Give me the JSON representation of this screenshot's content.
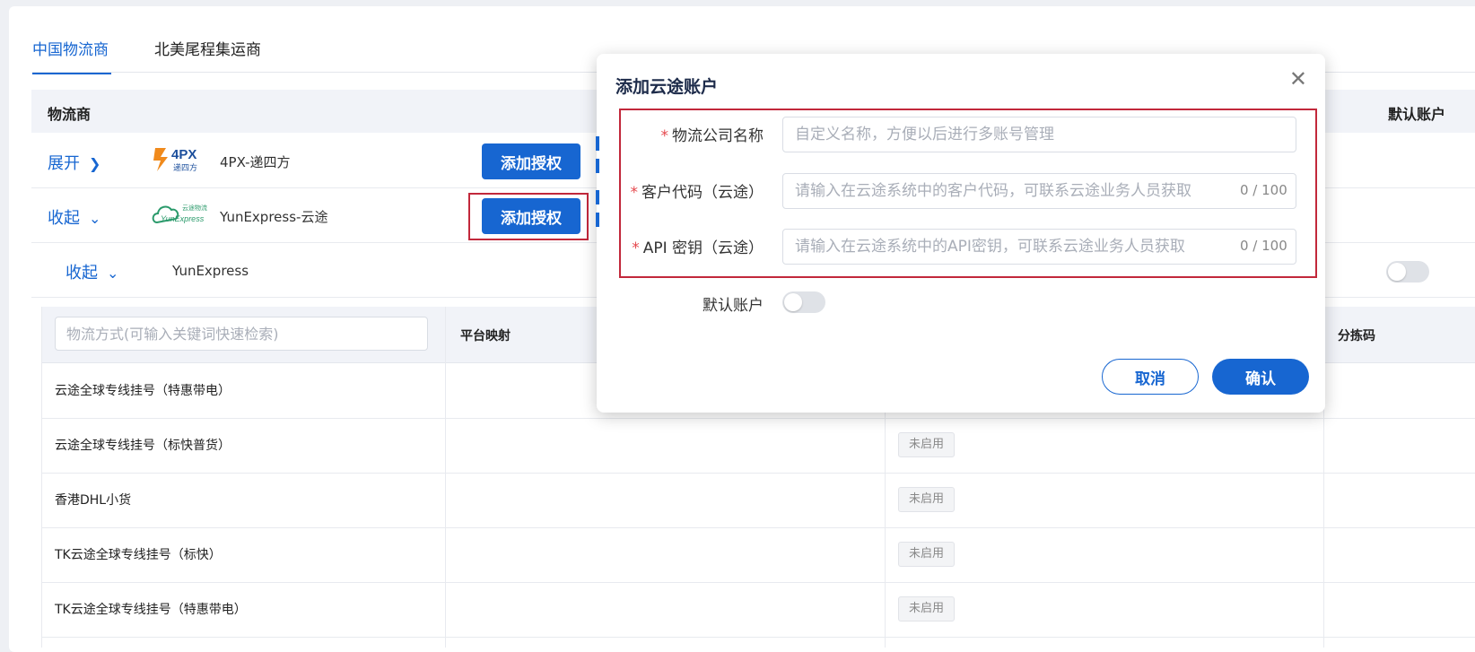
{
  "tabs": [
    {
      "label": "中国物流商",
      "active": true
    },
    {
      "label": "北美尾程集运商",
      "active": false
    }
  ],
  "providers_table": {
    "col_provider": "物流商",
    "col_default": "默认账户",
    "rows": [
      {
        "toggle": "展开",
        "logo": "4PX-logo",
        "name": "4PX-递四方",
        "button": "添加授权"
      },
      {
        "toggle": "收起",
        "logo": "yunexpress-logo",
        "name": "YunExpress-云途",
        "button": "添加授权"
      }
    ],
    "account_row": {
      "toggle": "收起",
      "name": "YunExpress",
      "default_on": false
    }
  },
  "methods_table": {
    "search_placeholder": "物流方式(可输入关键词快速检索)",
    "col_mapping": "平台映射",
    "col_sort": "分拣码",
    "rows": [
      {
        "name": "云途全球专线挂号（特惠带电）",
        "status": ""
      },
      {
        "name": "云途全球专线挂号（标快普货）",
        "status": "未启用"
      },
      {
        "name": "香港DHL小货",
        "status": "未启用"
      },
      {
        "name": "TK云途全球专线挂号（标快）",
        "status": "未启用"
      },
      {
        "name": "TK云途全球专线挂号（特惠带电）",
        "status": "未启用"
      }
    ]
  },
  "modal": {
    "title": "添加云途账户",
    "fields": [
      {
        "label": "物流公司名称",
        "required": true,
        "placeholder": "自定义名称，方便以后进行多账号管理",
        "counter": ""
      },
      {
        "label": "客户代码（云途）",
        "required": true,
        "placeholder": "请输入在云途系统中的客户代码，可联系云途业务人员获取",
        "counter": "0 / 100"
      },
      {
        "label": "API 密钥（云途）",
        "required": true,
        "placeholder": "请输入在云途系统中的API密钥，可联系云途业务人员获取",
        "counter": "0 / 100"
      }
    ],
    "default_label": "默认账户",
    "default_on": false,
    "cancel_label": "取消",
    "confirm_label": "确认"
  },
  "colors": {
    "primary": "#1766d1",
    "highlight": "#c2283b",
    "required": "#e5484d"
  }
}
